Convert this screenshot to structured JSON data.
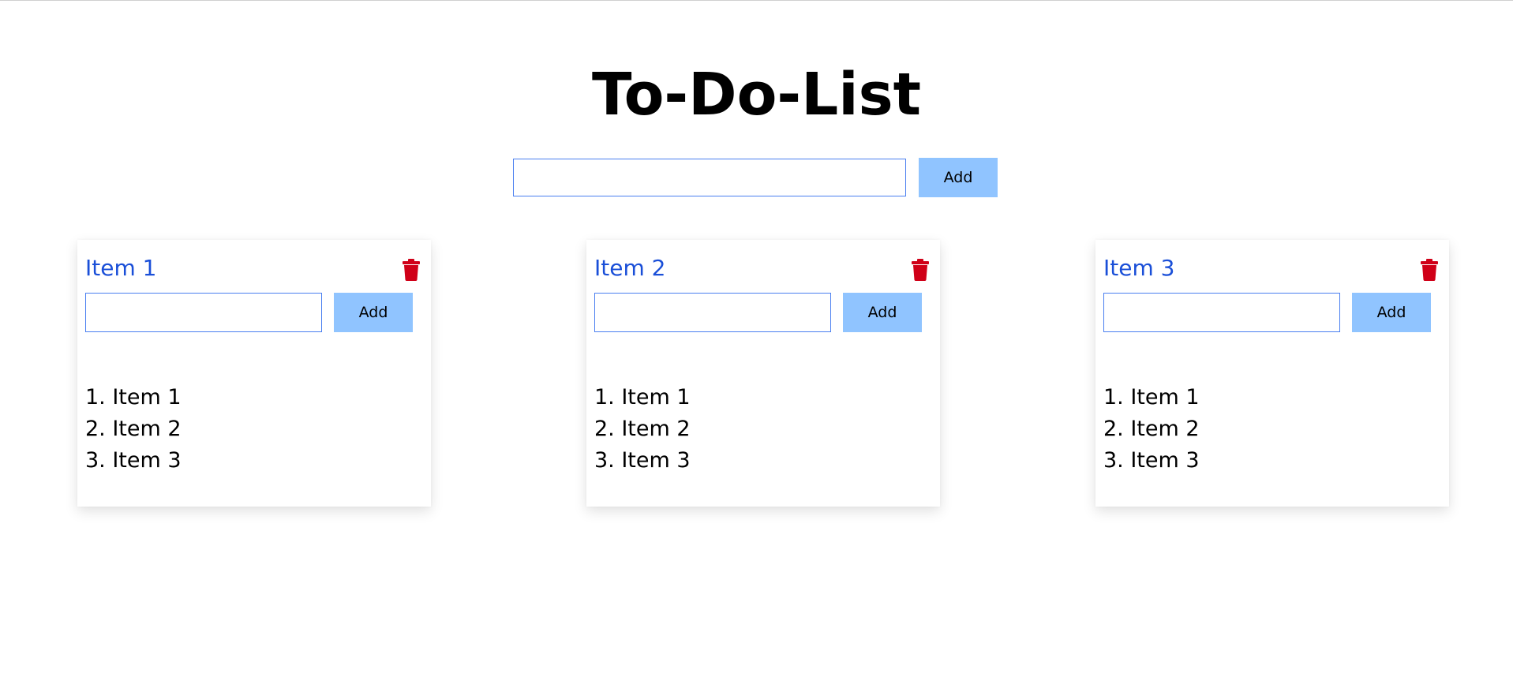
{
  "page": {
    "title": "To-Do-List"
  },
  "main_form": {
    "input_value": "",
    "input_placeholder": "",
    "add_label": "Add"
  },
  "colors": {
    "title_text": "#000000",
    "card_title": "#1a4fd8",
    "add_button_bg": "#90c4ff",
    "input_border": "#4a7ff0",
    "trash_icon": "#d00018"
  },
  "cards": [
    {
      "title": "Item 1",
      "input_value": "",
      "add_label": "Add",
      "delete_icon": "trash-icon",
      "items": [
        "1. Item 1",
        "2. Item 2",
        "3. Item 3"
      ]
    },
    {
      "title": "Item 2",
      "input_value": "",
      "add_label": "Add",
      "delete_icon": "trash-icon",
      "items": [
        "1. Item 1",
        "2. Item 2",
        "3. Item 3"
      ]
    },
    {
      "title": "Item 3",
      "input_value": "",
      "add_label": "Add",
      "delete_icon": "trash-icon",
      "items": [
        "1. Item 1",
        "2. Item 2",
        "3. Item 3"
      ]
    }
  ]
}
